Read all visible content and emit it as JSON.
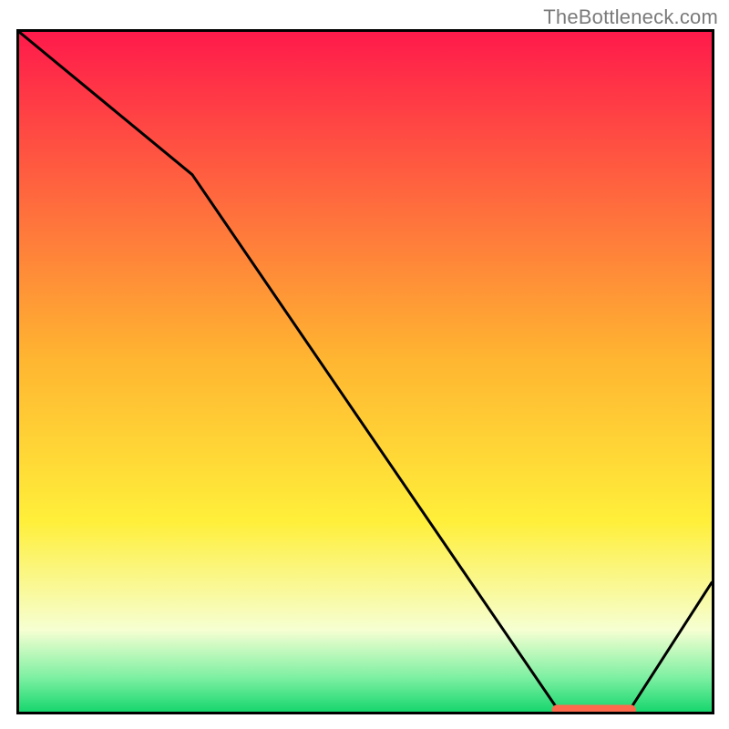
{
  "attribution": "TheBottleneck.com",
  "colors": {
    "gradient_top": "#ff1a4b",
    "gradient_mid": "#ffef3a",
    "gradient_bot1": "#f6ffd2",
    "gradient_bot2": "#7df0a2",
    "gradient_bot3": "#17d66e",
    "frame": "#000000",
    "line": "#000000",
    "marker_fill": "#ff6a4d",
    "marker_stroke": "#ff6a4d"
  },
  "chart_data": {
    "type": "line",
    "title": "",
    "xlabel": "",
    "ylabel": "",
    "xlim": [
      0,
      100
    ],
    "ylim": [
      0,
      100
    ],
    "x": [
      0,
      25,
      78,
      88,
      100
    ],
    "values": [
      100,
      79,
      0,
      0,
      19
    ],
    "marker": {
      "x_range": [
        77,
        89
      ],
      "y": 0
    },
    "annotations": []
  }
}
